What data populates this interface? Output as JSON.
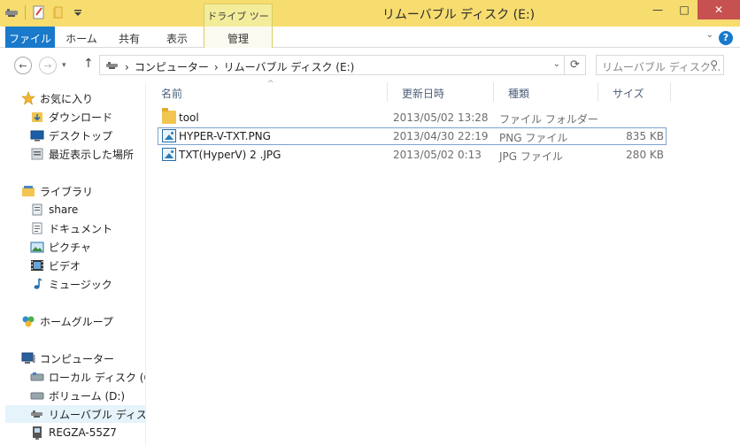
{
  "window": {
    "title": "リムーバブル ディスク (E:)",
    "context_tab_group": "ドライブ ツール",
    "minimize": "—",
    "maximize": "□",
    "close": "✕"
  },
  "ribbon": {
    "tabs": [
      {
        "label": "ファイル"
      },
      {
        "label": "ホーム"
      },
      {
        "label": "共有"
      },
      {
        "label": "表示"
      },
      {
        "label": "管理"
      }
    ],
    "help": "?",
    "collapse": "⌄"
  },
  "address": {
    "back": "←",
    "forward": "→",
    "up": "↑",
    "crumbs": [
      "コンピューター",
      "リムーバブル ディスク (E:)"
    ],
    "separator": "›",
    "dropdown": "⌄",
    "refresh": "⟳",
    "search_placeholder": "リムーバブル ディスク...",
    "search_icon": "⚲"
  },
  "nav": {
    "favorites": "お気に入り",
    "downloads": "ダウンロード",
    "desktop": "デスクトップ",
    "recent": "最近表示した場所",
    "libraries": "ライブラリ",
    "share": "share",
    "documents": "ドキュメント",
    "pictures": "ピクチャ",
    "videos": "ビデオ",
    "music": "ミュージック",
    "homegroup": "ホームグループ",
    "computer": "コンピューター",
    "local_disk": "ローカル ディスク (C:)",
    "volume_d": "ボリューム (D:)",
    "removable_e": "リムーバブル ディスク (E:)",
    "regza": "REGZA-55Z7"
  },
  "columns": {
    "name": "名前",
    "date": "更新日時",
    "type": "種類",
    "size": "サイズ",
    "sort_indicator": "^"
  },
  "files": [
    {
      "name": "tool",
      "date": "2013/05/02 13:28",
      "type": "ファイル フォルダー",
      "size": ""
    },
    {
      "name": "HYPER-V-TXT.PNG",
      "date": "2013/04/30 22:19",
      "type": "PNG ファイル",
      "size": "835 KB"
    },
    {
      "name": "TXT(HyperV) 2 .JPG",
      "date": "2013/05/02 0:13",
      "type": "JPG ファイル",
      "size": "280 KB"
    }
  ],
  "colors": {
    "titlebar": "#f7dc6f",
    "file_tab": "#1979ca",
    "close_button": "#c75050",
    "header_text": "#4c607a"
  }
}
